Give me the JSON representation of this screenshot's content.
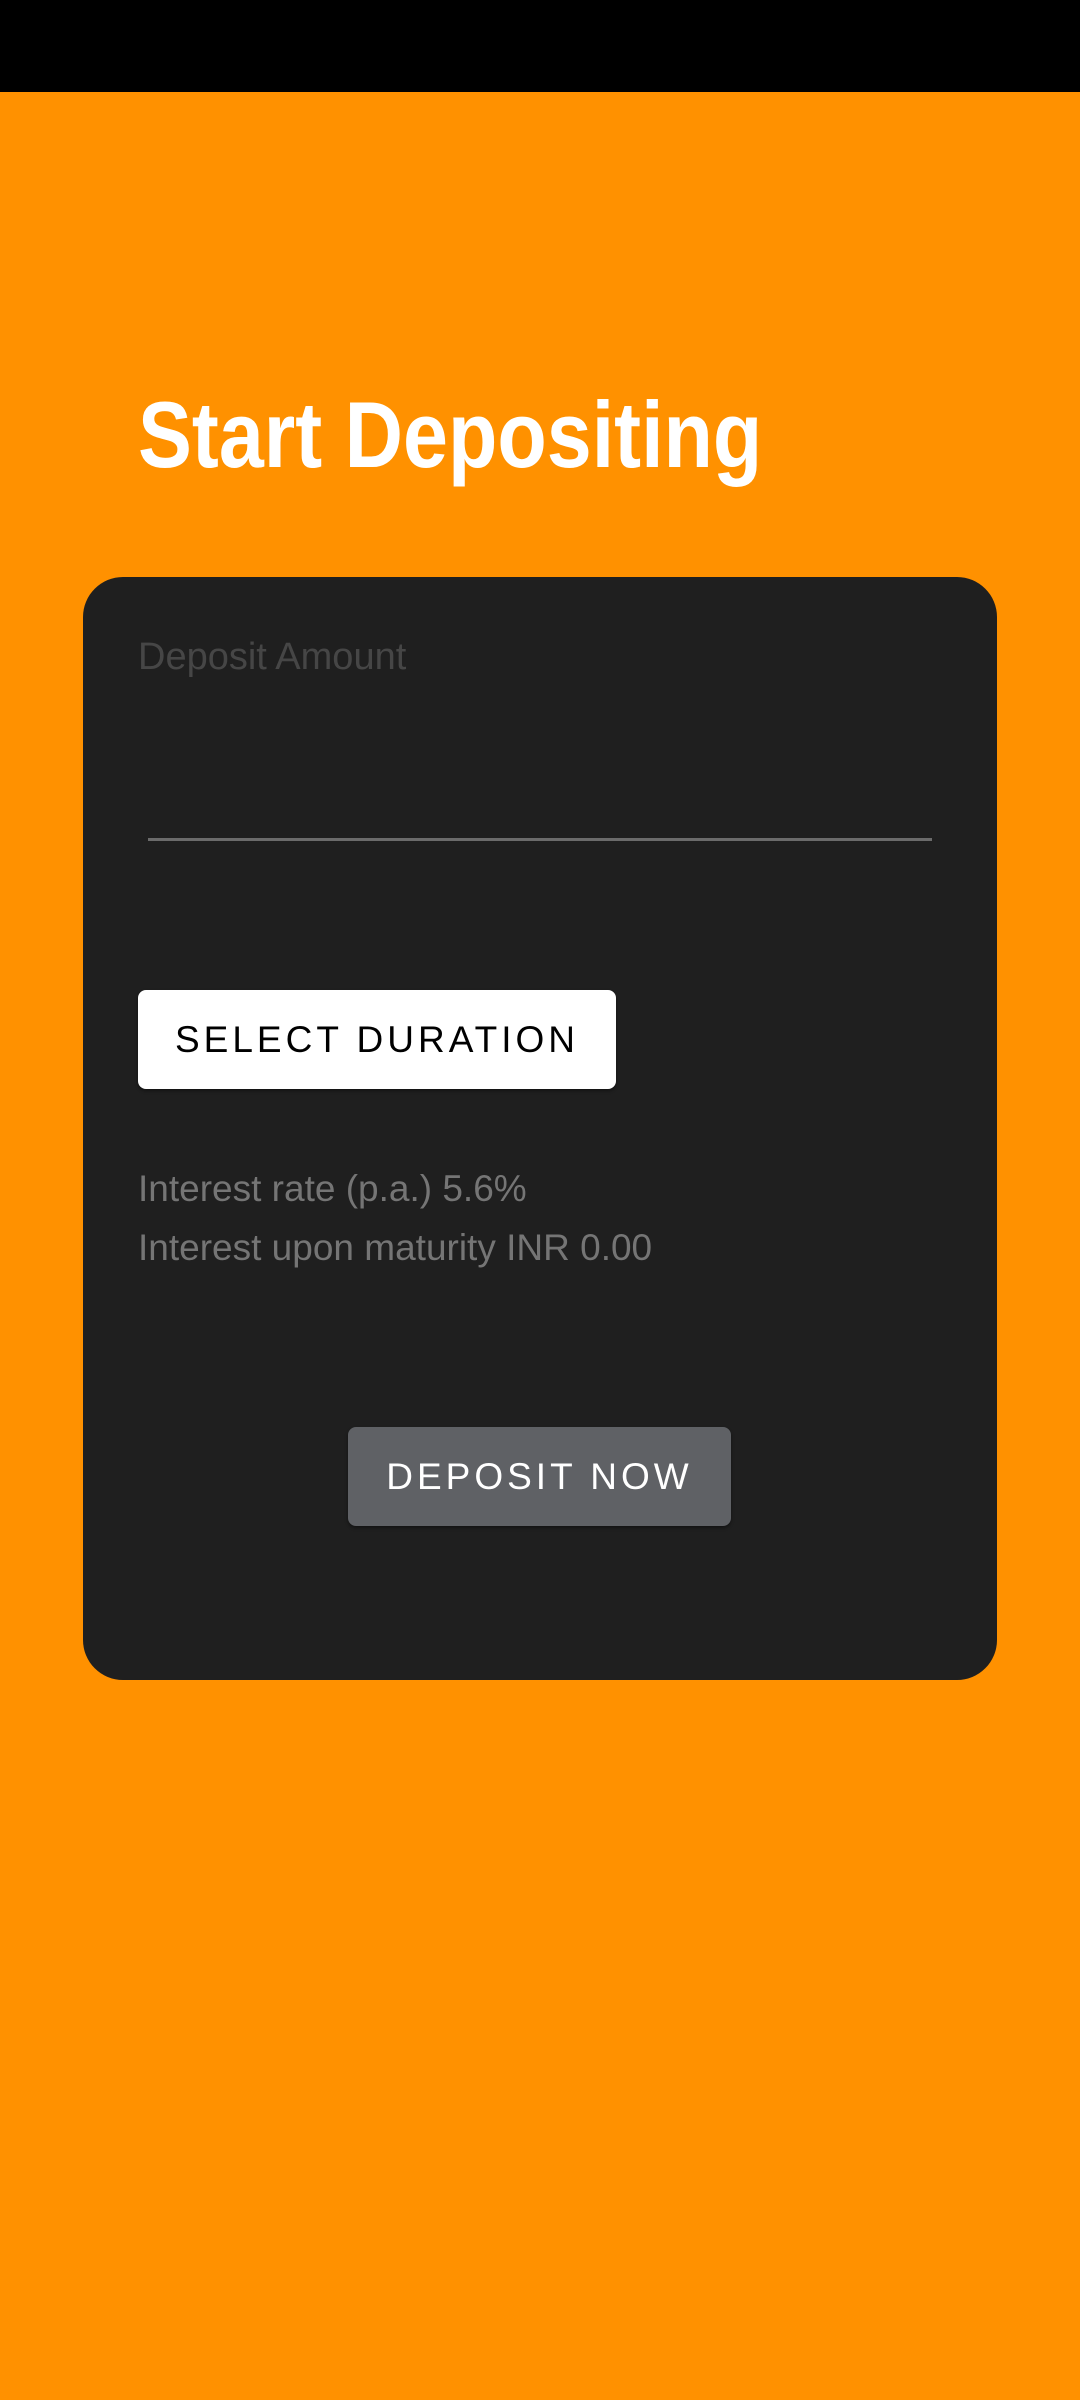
{
  "colors": {
    "background": "#FF9100",
    "status_bar": "#000000",
    "card": "#1F1F1F",
    "title_text": "#FFFFFF",
    "info_text": "#757575",
    "placeholder_text": "#464646",
    "select_button_bg": "#FFFFFF",
    "deposit_button_bg": "#5F6165"
  },
  "header": {
    "title": "Start Depositing"
  },
  "form": {
    "amount": {
      "placeholder": "Deposit Amount",
      "value": ""
    },
    "select_duration_label": "SELECT DURATION",
    "interest_rate_text": "Interest rate (p.a.) 5.6%",
    "interest_maturity_text": "Interest upon maturity INR 0.00",
    "deposit_button_label": "DEPOSIT NOW"
  }
}
